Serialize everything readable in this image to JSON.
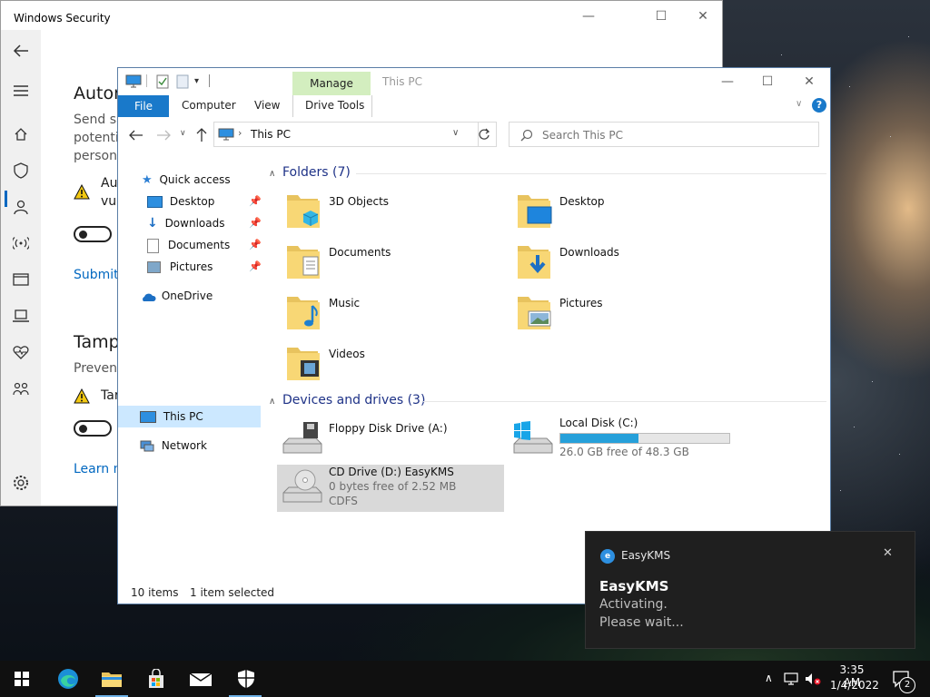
{
  "security": {
    "title": "Windows Security",
    "h1": "Autor",
    "desc": [
      "Send sa",
      "potenti",
      "persona"
    ],
    "warn1": [
      "Au",
      "vul"
    ],
    "submit_link": "Submit",
    "h2": "Tamp",
    "prevent": "Prevent",
    "warn2": "Tar",
    "learn_link": "Learn m"
  },
  "explorer": {
    "context_tab": "Manage",
    "title": "This PC",
    "ribbon_tabs": {
      "file": "File",
      "computer": "Computer",
      "view": "View",
      "drive_tools": "Drive Tools"
    },
    "address": "This PC",
    "search_placeholder": "Search This PC",
    "nav": {
      "quick_access": "Quick access",
      "desktop": "Desktop",
      "downloads": "Downloads",
      "documents": "Documents",
      "pictures": "Pictures",
      "onedrive": "OneDrive",
      "this_pc": "This PC",
      "network": "Network"
    },
    "folders_header": "Folders (7)",
    "folders": [
      "3D Objects",
      "Desktop",
      "Documents",
      "Downloads",
      "Music",
      "Pictures",
      "Videos"
    ],
    "devices_header": "Devices and drives (3)",
    "drives": {
      "floppy": {
        "name": "Floppy Disk Drive (A:)"
      },
      "local": {
        "name": "Local Disk (C:)",
        "free": "26.0 GB free of 48.3 GB",
        "used_fraction": 0.46
      },
      "cd": {
        "name": "CD Drive (D:) EasyKMS",
        "free": "0 bytes free of 2.52 MB",
        "fs": "CDFS"
      }
    },
    "status": {
      "items": "10 items",
      "selected": "1 item selected"
    }
  },
  "toast": {
    "app": "EasyKMS",
    "title": "EasyKMS",
    "line1": "Activating.",
    "line2": "Please wait..."
  },
  "taskbar": {
    "time": "3:35 AM",
    "date": "1/4/2022",
    "notifications": "2"
  }
}
